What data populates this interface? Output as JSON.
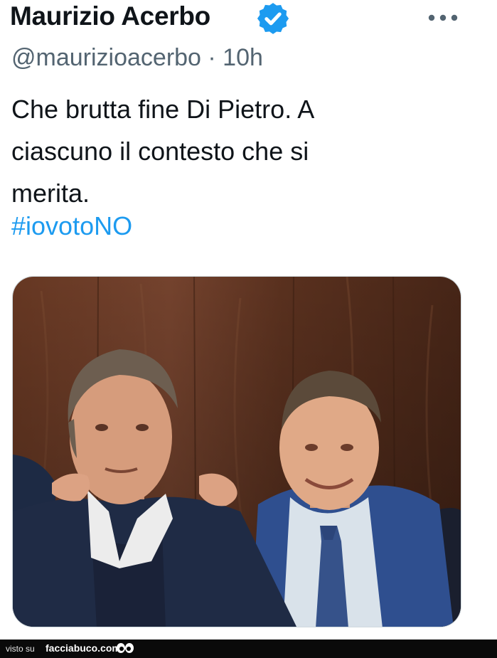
{
  "tweet": {
    "author_name": "Maurizio Acerbo",
    "handle_time": "@maurizioacerbo · 10h",
    "text_lines": [
      "Che brutta fine Di Pietro. A",
      "ciascuno il contesto che si",
      "merita."
    ],
    "hashtag": "#iovotoNO"
  },
  "icons": {
    "verified": "verified-badge-icon",
    "more": "more-options-icon"
  },
  "colors": {
    "text": "#0f1419",
    "secondary": "#536471",
    "accent": "#1d9bf0"
  },
  "footer": {
    "prefix": "visto su",
    "site": "facciabuco.com"
  }
}
